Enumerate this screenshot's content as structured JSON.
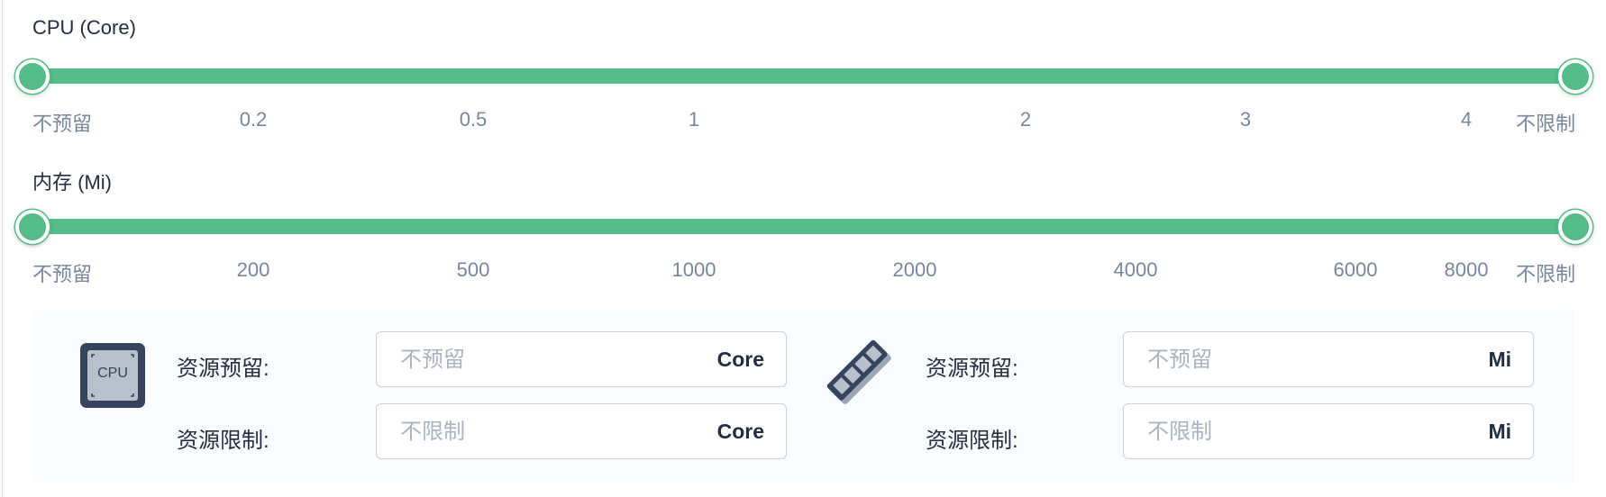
{
  "cpu_slider": {
    "label": "CPU (Core)",
    "ticks": [
      "不预留",
      "0.2",
      "0.5",
      "1",
      "2",
      "3",
      "4",
      "不限制"
    ],
    "min_value": "不预留",
    "max_value": "不限制",
    "color": "#55bc8a"
  },
  "memory_slider": {
    "label": "内存 (Mi)",
    "ticks": [
      "不预留",
      "200",
      "500",
      "1000",
      "2000",
      "4000",
      "6000",
      "8000",
      "不限制"
    ],
    "min_value": "不预留",
    "max_value": "不限制",
    "color": "#55bc8a"
  },
  "cpu_resources": {
    "icon": "cpu-icon",
    "icon_text": "CPU",
    "reserve_label": "资源预留:",
    "reserve_placeholder": "不预留",
    "reserve_value": "",
    "limit_label": "资源限制:",
    "limit_placeholder": "不限制",
    "limit_value": "",
    "unit": "Core"
  },
  "memory_resources": {
    "icon": "memory-icon",
    "reserve_label": "资源预留:",
    "reserve_placeholder": "不预留",
    "reserve_value": "",
    "limit_label": "资源限制:",
    "limit_placeholder": "不限制",
    "limit_value": "",
    "unit": "Mi"
  }
}
